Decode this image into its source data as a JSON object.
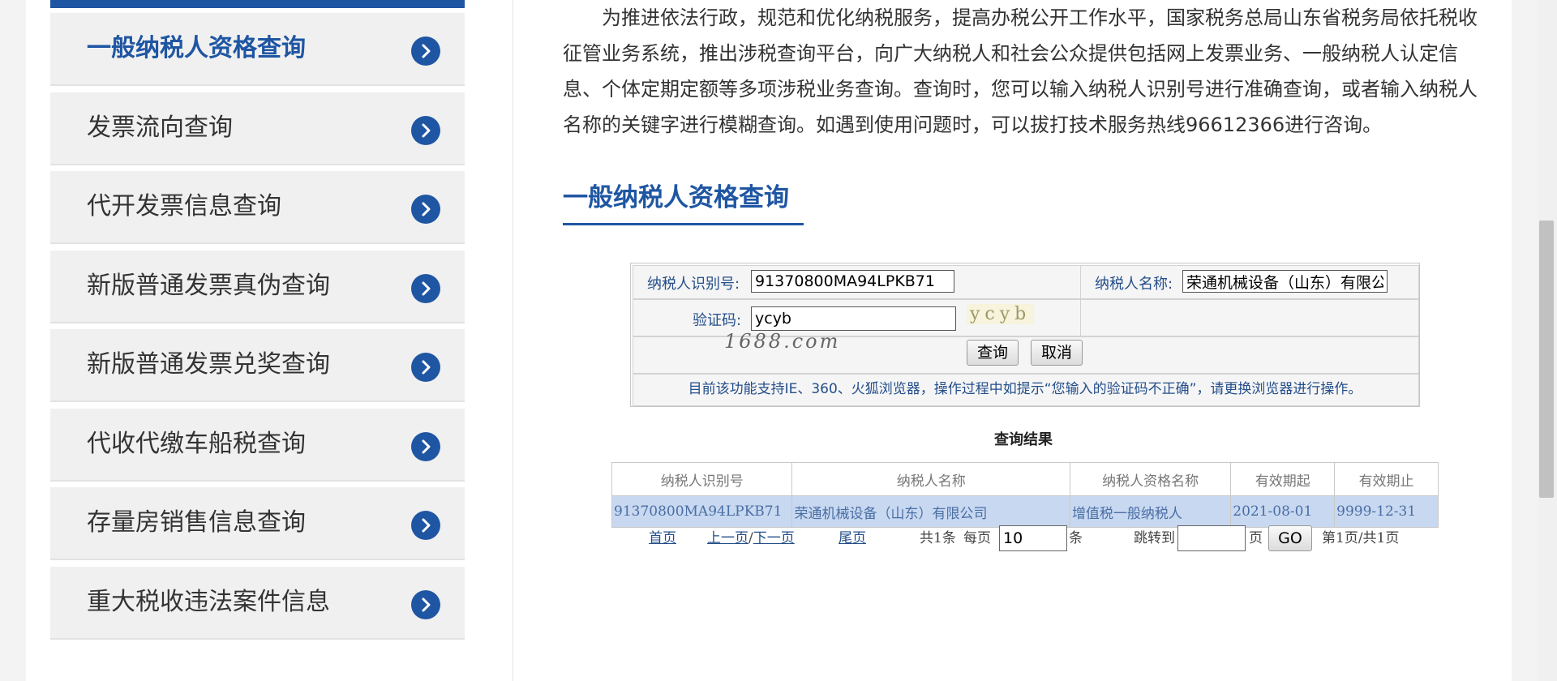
{
  "sidebar": {
    "items": [
      {
        "label": "一般纳税人资格查询",
        "active": true
      },
      {
        "label": "发票流向查询"
      },
      {
        "label": "代开发票信息查询"
      },
      {
        "label": "新版普通发票真伪查询"
      },
      {
        "label": "新版普通发票兑奖查询"
      },
      {
        "label": "代收代缴车船税查询"
      },
      {
        "label": "存量房销售信息查询"
      },
      {
        "label": "重大税收违法案件信息"
      }
    ]
  },
  "intro": "为推进依法行政，规范和优化纳税服务，提高办税公开工作水平，国家税务总局山东省税务局依托税收征管业务系统，推出涉税查询平台，向广大纳税人和社会公众提供包括网上发票业务、一般纳税人认定信息、个体定期定额等多项涉税业务查询。查询时，您可以输入纳税人识别号进行准确查询，或者输入纳税人名称的关键字进行模糊查询。如遇到使用问题时，可以拔打技术服务热线96612366进行咨询。",
  "section_title": "一般纳税人资格查询",
  "form": {
    "taxpayer_id_label": "纳税人识别号:",
    "taxpayer_id_value": "91370800MA94LPKB71",
    "taxpayer_name_label": "纳税人名称:",
    "taxpayer_name_value": "荣通机械设备（山东）有限公司",
    "captcha_label": "验证码:",
    "captcha_value": "ycyb",
    "captcha_image_text": "ycyb",
    "watermark": "1688.com",
    "query_button": "查询",
    "cancel_button": "取消",
    "notice": "目前该功能支持IE、360、火狐浏览器，操作过程中如提示“您输入的验证码不正确”，请更换浏览器进行操作。"
  },
  "results": {
    "title": "查询结果",
    "columns": [
      "纳税人识别号",
      "纳税人名称",
      "纳税人资格名称",
      "有效期起",
      "有效期止"
    ],
    "rows": [
      [
        "91370800MA94LPKB71",
        "荣通机械设备（山东）有限公司",
        "增值税一般纳税人",
        "2021-08-01",
        "9999-12-31"
      ]
    ]
  },
  "pager": {
    "first": "首页",
    "prev": "上一页",
    "slash": "/",
    "next": "下一页",
    "last": "尾页",
    "total": "共1条",
    "per_page_label": "每页",
    "per_page_value": "10",
    "per_page_unit": "条",
    "jump_label": "跳转到",
    "jump_value": "",
    "jump_unit": "页",
    "go_button": "GO",
    "page_info": "第1页/共1页"
  },
  "colors": {
    "accent": "#1f56a3",
    "row_highlight": "#c7d8f0"
  }
}
